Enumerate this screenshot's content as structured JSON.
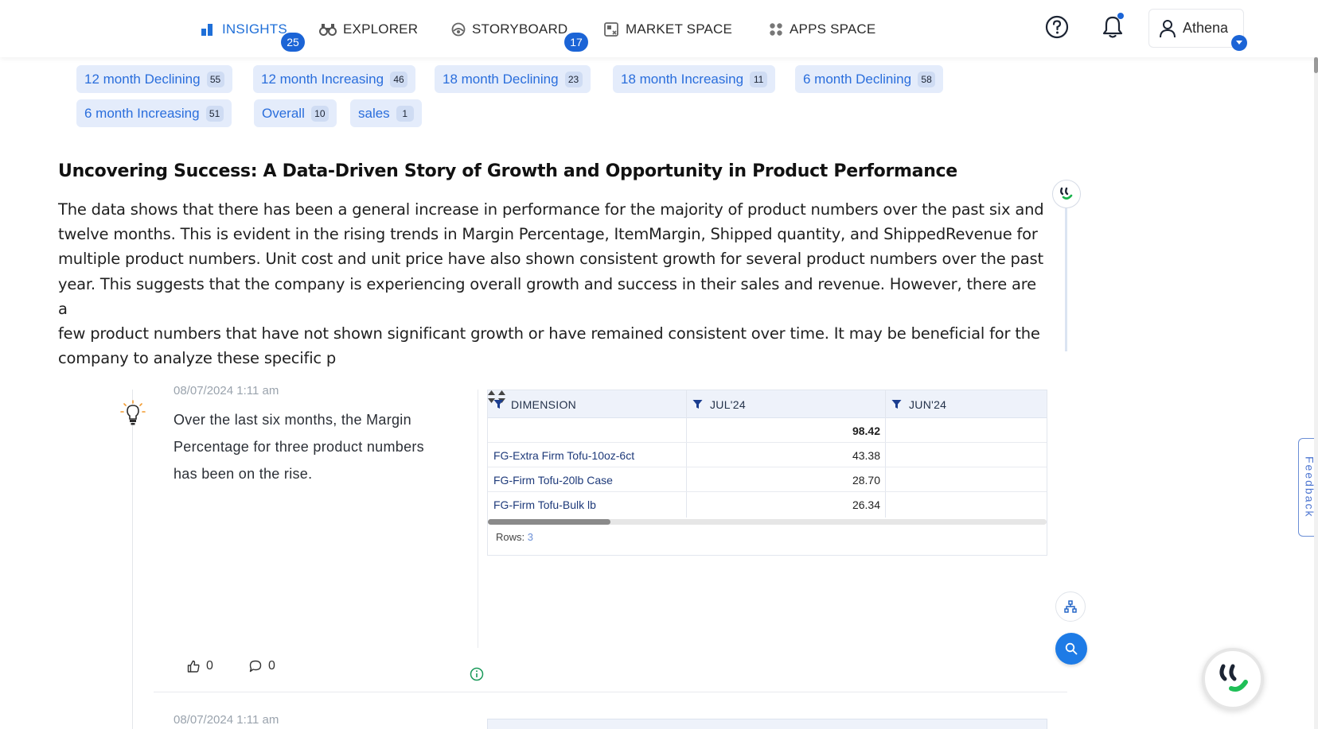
{
  "nav": {
    "items": [
      {
        "label": "INSIGHTS",
        "badge": "25",
        "icon": "bar-chart-icon",
        "active": true
      },
      {
        "label": "EXPLORER",
        "badge": "",
        "icon": "binoculars-icon",
        "active": false
      },
      {
        "label": "STORYBOARD",
        "badge": "17",
        "icon": "storyboard-icon",
        "active": false
      },
      {
        "label": "MARKET SPACE",
        "badge": "",
        "icon": "market-icon",
        "active": false
      },
      {
        "label": "APPS SPACE",
        "badge": "",
        "icon": "apps-grid-icon",
        "active": false
      }
    ],
    "help_icon": "help-circle-icon",
    "bell_icon": "bell-icon",
    "user_name": "Athena"
  },
  "tags": [
    {
      "label": "12 month Declining",
      "count": "55"
    },
    {
      "label": "12 month Increasing",
      "count": "46"
    },
    {
      "label": "18 month Declining",
      "count": "23"
    },
    {
      "label": "18 month Increasing",
      "count": "11"
    },
    {
      "label": "6 month Declining",
      "count": "58"
    },
    {
      "label": "6 month Increasing",
      "count": "51"
    },
    {
      "label": "Overall",
      "count": "10"
    },
    {
      "label": "sales",
      "count": "1"
    }
  ],
  "story": {
    "title": "Uncovering Success: A Data-Driven Story of Growth and Opportunity in Product Performance",
    "lines": [
      "The data shows that there has been a general increase in performance for the majority of product numbers over the past six and",
      "twelve months. This is evident in the rising trends in Margin Percentage, ItemMargin, Shipped quantity, and ShippedRevenue for",
      "multiple product numbers. Unit cost and unit price have also shown consistent growth for several product numbers over the past",
      "year. This suggests that the company is experiencing overall growth and success in their sales and revenue. However, there are a",
      "few product numbers that have not shown significant growth or have remained consistent over time. It may be beneficial for the",
      "company to analyze these specific p"
    ]
  },
  "insight": {
    "date": "08/07/2024 1:11 am",
    "lines": [
      "Over the last six months, the Margin",
      "Percentage for three product numbers",
      "has been on the rise."
    ],
    "likes": "0",
    "comments": "0",
    "table": {
      "columns": [
        "DIMENSION",
        "JUL'24",
        "JUN'24"
      ],
      "total": "98.42",
      "rows": [
        {
          "dimension": "FG-Extra Firm Tofu-10oz-6ct",
          "jul": "43.38",
          "jun": ""
        },
        {
          "dimension": "FG-Firm Tofu-20lb Case",
          "jul": "28.70",
          "jun": ""
        },
        {
          "dimension": "FG-Firm Tofu-Bulk lb",
          "jul": "26.34",
          "jun": ""
        }
      ],
      "rows_label": "Rows:",
      "rows_count": "3",
      "scroll_fraction": 0.22
    }
  },
  "next_insight": {
    "date": "08/07/2024 1:11 am"
  },
  "feedback_label": "Feedback",
  "colors": {
    "accent": "#1b64d6",
    "chip_bg": "#e4ecfb",
    "chip_text": "#2a6edc",
    "table_head": "#eef2fa"
  }
}
